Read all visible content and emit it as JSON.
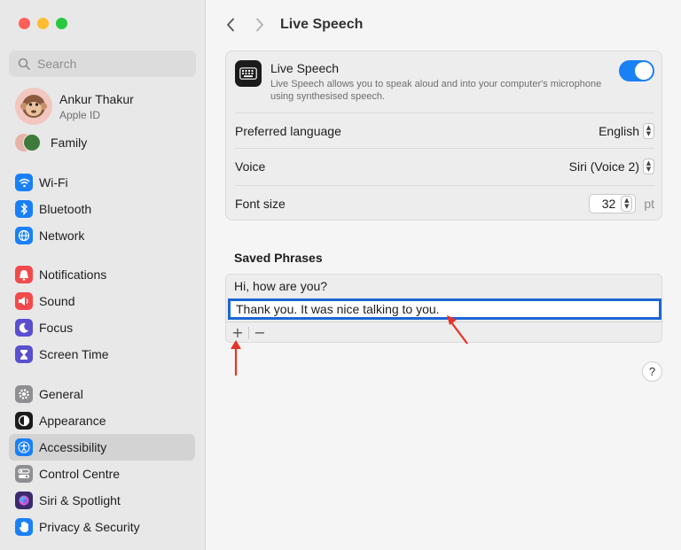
{
  "sidebar": {
    "search": {
      "placeholder": "Search"
    },
    "account": {
      "name": "Ankur Thakur",
      "subtitle": "Apple ID"
    },
    "family": {
      "label": "Family"
    },
    "group1": [
      {
        "label": "Wi-Fi",
        "icon": "wifi-icon",
        "color": "#1a80f5"
      },
      {
        "label": "Bluetooth",
        "icon": "bluetooth-icon",
        "color": "#1a80f5"
      },
      {
        "label": "Network",
        "icon": "globe-icon",
        "color": "#1a80f5"
      }
    ],
    "group2": [
      {
        "label": "Notifications",
        "icon": "bell-icon",
        "color": "#f24a4a"
      },
      {
        "label": "Sound",
        "icon": "speaker-icon",
        "color": "#f24a4a"
      },
      {
        "label": "Focus",
        "icon": "moon-icon",
        "color": "#5a4fcf"
      },
      {
        "label": "Screen Time",
        "icon": "hourglass-icon",
        "color": "#5a4fcf"
      }
    ],
    "group3": [
      {
        "label": "General",
        "icon": "gear-icon",
        "color": "#8e8e93"
      },
      {
        "label": "Appearance",
        "icon": "appearance-icon",
        "color": "#1b1b1b"
      },
      {
        "label": "Accessibility",
        "icon": "accessibility-icon",
        "color": "#1a80f5",
        "selected": true
      },
      {
        "label": "Control Centre",
        "icon": "control-centre-icon",
        "color": "#8e8e93"
      },
      {
        "label": "Siri & Spotlight",
        "icon": "siri-icon",
        "color": "#3b2a6e"
      },
      {
        "label": "Privacy & Security",
        "icon": "hand-icon",
        "color": "#1a80f5"
      }
    ]
  },
  "header": {
    "title": "Live Speech"
  },
  "live_speech": {
    "title": "Live Speech",
    "description": "Live Speech allows you to speak aloud and into your computer's microphone using synthesised speech.",
    "enabled": true
  },
  "settings": {
    "language": {
      "label": "Preferred language",
      "value": "English"
    },
    "voice": {
      "label": "Voice",
      "value": "Siri (Voice 2)"
    },
    "font_size": {
      "label": "Font size",
      "value": "32",
      "unit": "pt"
    }
  },
  "saved_phrases": {
    "title": "Saved Phrases",
    "items": [
      "Hi, how are you?",
      "Thank you. It was nice talking to you."
    ],
    "add_label": "+",
    "remove_label": "−"
  },
  "help": {
    "label": "?"
  },
  "colors": {
    "accent": "#1a80f5",
    "annotation": "#e8322b",
    "selection": "#1c66d4"
  }
}
